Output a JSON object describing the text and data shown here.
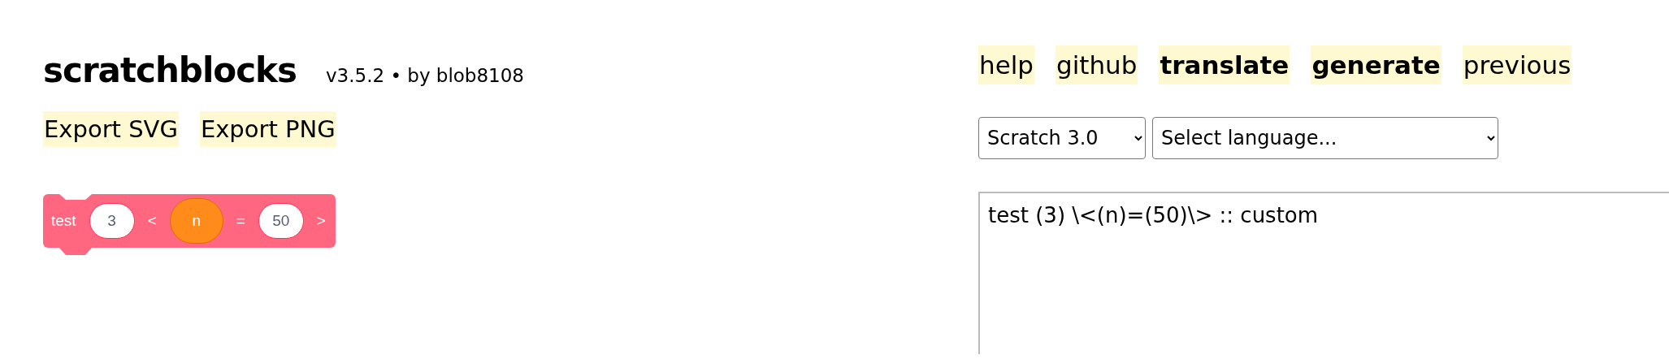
{
  "header": {
    "title": "scratchblocks",
    "version": "v3.5.2 • by blob8108"
  },
  "export_links": [
    "Export SVG",
    "Export PNG"
  ],
  "block": {
    "parts": [
      {
        "kind": "label",
        "text": "test"
      },
      {
        "kind": "number",
        "text": "3"
      },
      {
        "kind": "label",
        "text": "<"
      },
      {
        "kind": "reporter",
        "text": "n"
      },
      {
        "kind": "label",
        "text": "="
      },
      {
        "kind": "number",
        "text": "50"
      },
      {
        "kind": "label",
        "text": ">"
      }
    ]
  },
  "nav": [
    {
      "label": "help",
      "bold": false
    },
    {
      "label": "github",
      "bold": false
    },
    {
      "label": "translate",
      "bold": true
    },
    {
      "label": "generate",
      "bold": true
    },
    {
      "label": "previous",
      "bold": false
    }
  ],
  "version_select": {
    "value": "Scratch 3.0"
  },
  "language_select": {
    "value": "Select language..."
  },
  "editor": {
    "value": "test (3) \\<(n)=(50)\\> :: custom"
  }
}
